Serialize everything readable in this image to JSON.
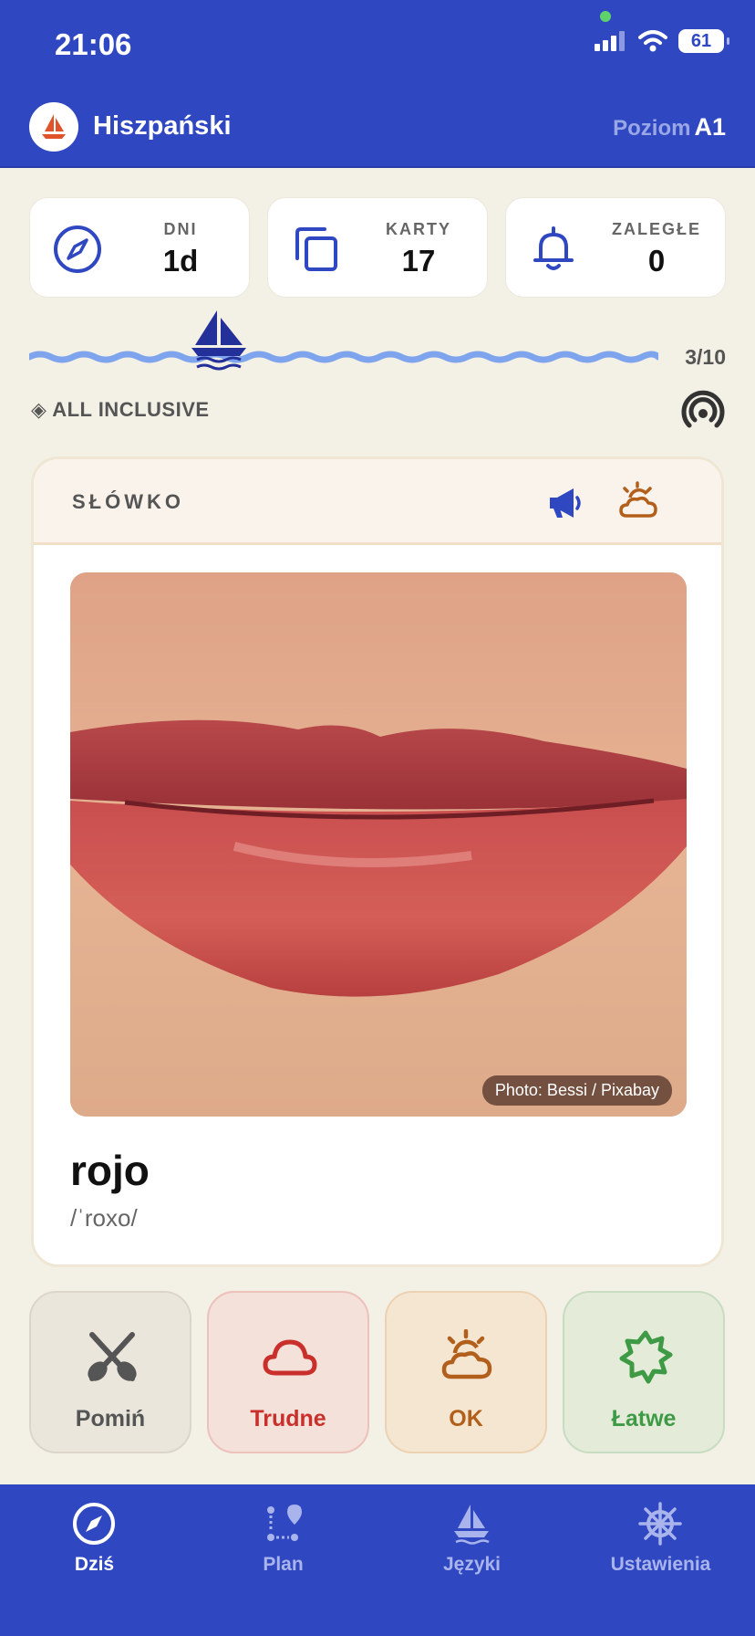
{
  "status_bar": {
    "time": "21:06",
    "battery": "61"
  },
  "header": {
    "title": "Hiszpański",
    "level_label": "Poziom",
    "level_value": "A1",
    "logo_icon": "sailboat-icon"
  },
  "stats": [
    {
      "label": "DNI",
      "value": "1d",
      "icon": "compass-icon"
    },
    {
      "label": "KARTY",
      "value": "17",
      "icon": "cards-icon"
    },
    {
      "label": "ZALEGŁE",
      "value": "0",
      "icon": "bell-icon"
    }
  ],
  "progress": {
    "text": "3/10",
    "current": 3,
    "total": 10
  },
  "plan_tag": "◈ ALL INCLUSIVE",
  "card": {
    "kind": "SŁÓWKO",
    "photo_credit": "Photo: Bessi / Pixabay",
    "word": "rojo",
    "pronunciation": "/ˈroxo/"
  },
  "answers": [
    {
      "label": "Pomiń",
      "icon": "oars-icon"
    },
    {
      "label": "Trudne",
      "icon": "cloud-icon"
    },
    {
      "label": "OK",
      "icon": "sun-cloud-icon"
    },
    {
      "label": "Łatwe",
      "icon": "star-icon"
    }
  ],
  "tabs": [
    {
      "label": "Dziś",
      "icon": "compass-icon",
      "active": true
    },
    {
      "label": "Plan",
      "icon": "route-icon",
      "active": false
    },
    {
      "label": "Języki",
      "icon": "sailboat-icon",
      "active": false
    },
    {
      "label": "Ustawienia",
      "icon": "helm-icon",
      "active": false
    }
  ],
  "colors": {
    "brand": "#3047c2",
    "background": "#f3f0e6",
    "wave": "#7ea4ee"
  }
}
